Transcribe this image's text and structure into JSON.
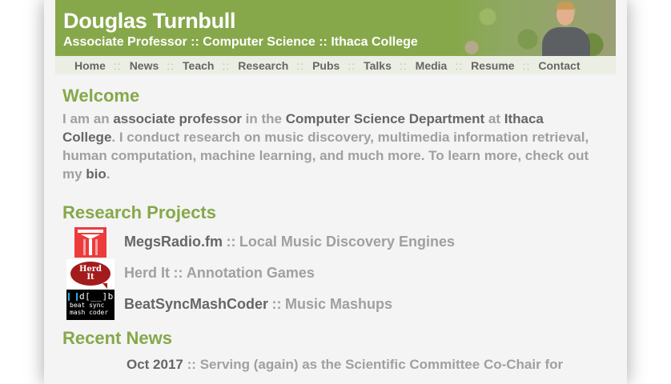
{
  "header": {
    "title": "Douglas Turnbull",
    "subtitle": "Associate Professor :: Computer Science :: Ithaca College"
  },
  "nav": {
    "separator": "::",
    "items": [
      "Home",
      "News",
      "Teach",
      "Research",
      "Pubs",
      "Talks",
      "Media",
      "Resume",
      "Contact"
    ]
  },
  "welcome": {
    "heading": "Welcome",
    "p1": "I am an ",
    "role": "associate professor",
    "p2": " in the ",
    "dept": "Computer Science Department",
    "p3": " at ",
    "college": "Ithaca College",
    "p4": ". I conduct research on music discovery, multimedia information retrieval, human computation, machine learning, and much more. To learn more, check out my ",
    "bio": "bio",
    "p5": "."
  },
  "research": {
    "heading": "Research Projects",
    "separator": "::",
    "projects": [
      {
        "name": "MegsRadio.fm",
        "description": "Local Music Discovery Engines",
        "icon": "megsradio-logo-icon"
      },
      {
        "name": "Herd It",
        "description": "Annotation Games",
        "icon": "herd-it-logo-icon",
        "logo_text_1": "Herd",
        "logo_text_2": "It"
      },
      {
        "name": "BeatSyncMashCoder",
        "description": "Music Mashups",
        "icon": "beatsync-logo-icon",
        "logo_text_1": "d[__]b",
        "logo_text_2": "beat sync",
        "logo_text_3": "mash coder"
      }
    ]
  },
  "news": {
    "heading": "Recent News",
    "items": [
      {
        "date": "Oct 2017",
        "separator": "::",
        "text": "Serving (again) as the Scientific Committee Co-Chair for"
      }
    ]
  },
  "colors": {
    "accent_green": "#86a84a",
    "text_dark": "#666666",
    "text_light": "#a0a0a0",
    "page_bg": "#f4f4f4"
  }
}
